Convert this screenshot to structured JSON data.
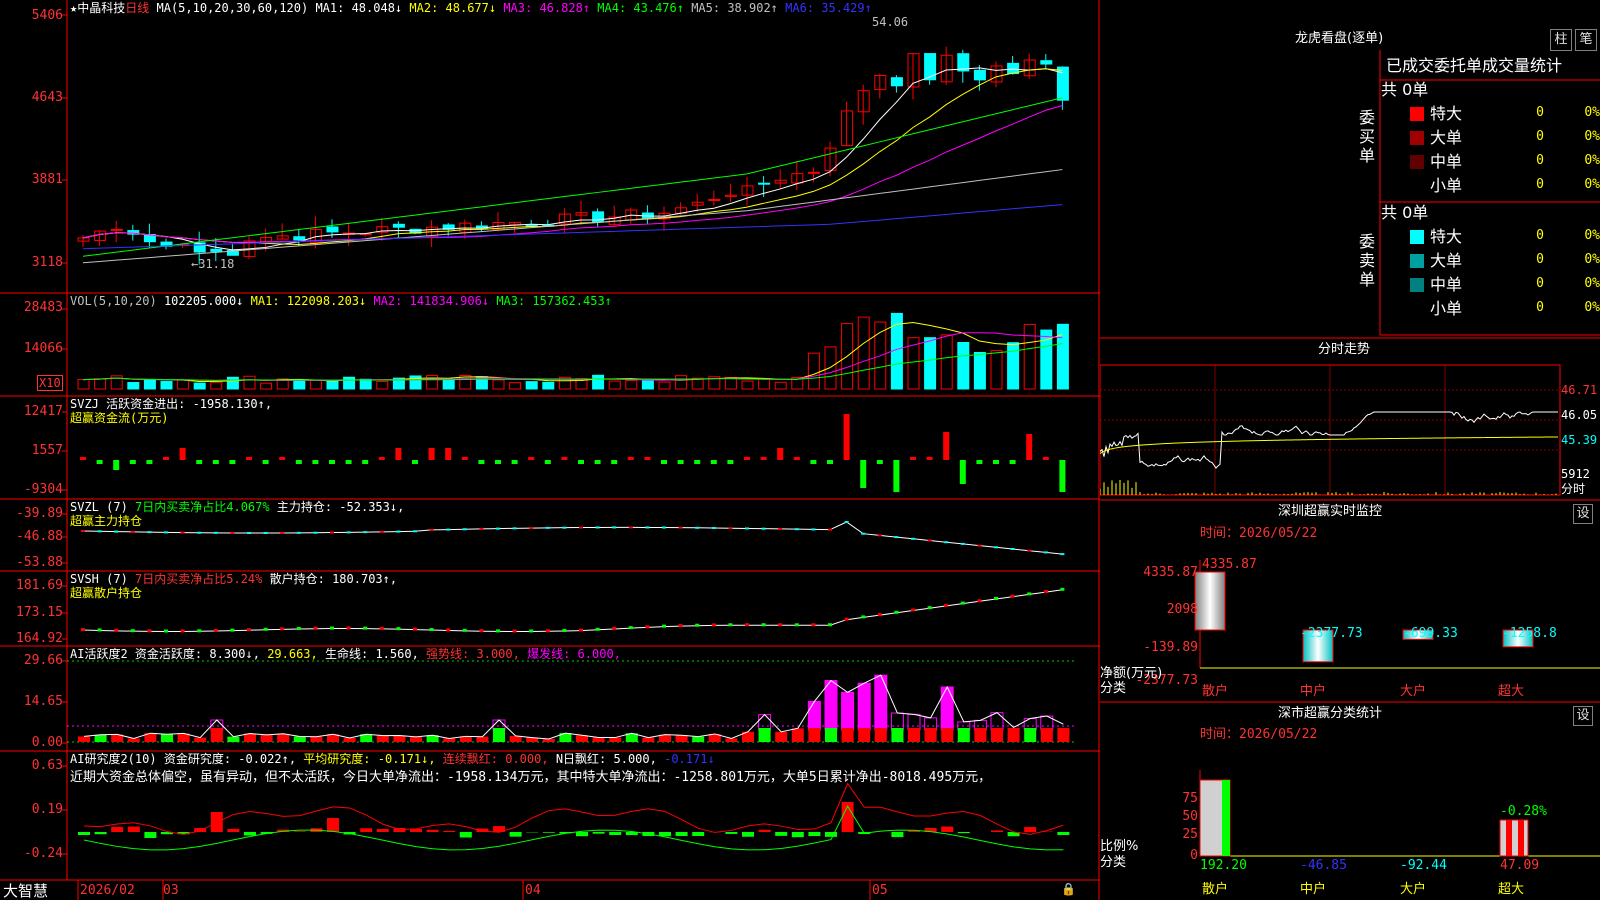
{
  "stock": {
    "star": "★",
    "name": "中晶科技",
    "period": "日线"
  },
  "price_panel": {
    "ma_params": "MA(5,10,20,30,60,120)",
    "ma": [
      {
        "label": "MA1: 48.048↓",
        "color": "#ffffff"
      },
      {
        "label": "MA2: 48.677↓",
        "color": "#ffff00"
      },
      {
        "label": "MA3: 46.828↑",
        "color": "#ff00ff"
      },
      {
        "label": "MA4: 43.476↑",
        "color": "#00ff00"
      },
      {
        "label": "MA5: 38.902↑",
        "color": "#c0c0c0"
      },
      {
        "label": "MA6: 35.429↑",
        "color": "#3333ff"
      }
    ],
    "y_ticks": [
      "5406",
      "4643",
      "3881",
      "3118"
    ],
    "high_mark": "54.06",
    "low_mark": "←31.18"
  },
  "vol_panel": {
    "title": "VOL(5,10,20)",
    "items": [
      {
        "label": "102205.000↓",
        "color": "#ffffff"
      },
      {
        "label": "MA1: 122098.203↓",
        "color": "#ffff00"
      },
      {
        "label": "MA2: 141834.906↓",
        "color": "#ff00ff"
      },
      {
        "label": "MA3: 157362.453↑",
        "color": "#00ff00"
      }
    ],
    "y_ticks": [
      "28483",
      "14066"
    ],
    "unit": "X10"
  },
  "svzj_panel": {
    "line1": [
      {
        "label": "SVZJ  活跃资金进出: -1958.130↑,",
        "color": "#ffffff"
      }
    ],
    "line2": "超赢资金流(万元)",
    "y_ticks": [
      "12417",
      "1557",
      "-9304"
    ]
  },
  "svzl_panel": {
    "line1": [
      {
        "label": "SVZL (7)",
        "color": "#ffffff"
      },
      {
        "label": "7日内买卖净占比4.067%",
        "color": "#00ff00"
      },
      {
        "label": "主力持仓: -52.353↓,",
        "color": "#ffffff"
      }
    ],
    "line2": "超赢主力持仓",
    "y_ticks": [
      "-39.89",
      "-46.88",
      "-53.88"
    ]
  },
  "svsh_panel": {
    "line1": [
      {
        "label": "SVSH (7)",
        "color": "#ffffff"
      },
      {
        "label": "7日内买卖净占比5.24%",
        "color": "#ff3333"
      },
      {
        "label": "散户持仓: 180.703↑,",
        "color": "#ffffff"
      }
    ],
    "line2": "超赢散户持仓",
    "y_ticks": [
      "181.69",
      "173.15",
      "164.92"
    ]
  },
  "ai_active_panel": {
    "line1": [
      {
        "label": "AI活跃度2",
        "color": "#ffffff"
      },
      {
        "label": "资金活跃度: 8.300↓,",
        "color": "#ffffff"
      },
      {
        "label": "29.663,",
        "color": "#ffff00"
      },
      {
        "label": "生命线: 1.560,",
        "color": "#ffffff"
      },
      {
        "label": "强势线: 3.000,",
        "color": "#ff3333"
      },
      {
        "label": "爆发线: 6.000,",
        "color": "#ff00ff"
      }
    ],
    "y_ticks": [
      "29.66",
      "14.65",
      "0.00"
    ]
  },
  "ai_research_panel": {
    "line1": [
      {
        "label": "AI研究度2(10)",
        "color": "#ffffff"
      },
      {
        "label": "资金研究度: -0.022↑,",
        "color": "#ffffff"
      },
      {
        "label": "平均研究度: -0.171↓,",
        "color": "#ffff00"
      },
      {
        "label": "连续飘红: 0.000,",
        "color": "#ff3333"
      },
      {
        "label": "N日飘红: 5.000,",
        "color": "#ffffff"
      },
      {
        "label": "-0.171↓",
        "color": "#3333ff"
      }
    ],
    "comment": "近期大资金总体偏空，虽有异动，但不太活跃，今日大单净流出：-1958.134万元，其中特大单净流出：-1258.801万元，大单5日累计净出-8018.495万元，",
    "y_ticks": [
      "0.63",
      "0.19",
      "-0.24"
    ]
  },
  "bottom_axis": {
    "logo": "大智慧",
    "dates": [
      "2026/02",
      "03",
      "04",
      "05"
    ]
  },
  "dragon_tiger": {
    "title": "龙虎看盘(逐单)",
    "btn_bar": "柱",
    "btn_pen": "笔",
    "tabs": [
      "已成交",
      "委托单",
      "成交量统计"
    ],
    "buy_label": "委买单",
    "sell_label": "委卖单",
    "buy_total": "共 0单",
    "sell_total": "共 0单",
    "buy_rows": [
      {
        "name": "特大",
        "count": "0",
        "pct": "0%",
        "color": "#ff0000"
      },
      {
        "name": "大单",
        "count": "0",
        "pct": "0%",
        "color": "#a00000"
      },
      {
        "name": "中单",
        "count": "0",
        "pct": "0%",
        "color": "#600000"
      },
      {
        "name": "小单",
        "count": "0",
        "pct": "0%",
        "color": ""
      }
    ],
    "sell_rows": [
      {
        "name": "特大",
        "count": "0",
        "pct": "0%",
        "color": "#00ffff"
      },
      {
        "name": "大单",
        "count": "0",
        "pct": "0%",
        "color": "#00a0a0"
      },
      {
        "name": "中单",
        "count": "0",
        "pct": "0%",
        "color": "#008080"
      },
      {
        "name": "小单",
        "count": "0",
        "pct": "0%",
        "color": ""
      }
    ]
  },
  "intraday": {
    "title": "分时走势",
    "ticks_right": [
      "46.71",
      "46.05",
      "45.39",
      "5912",
      "分时"
    ]
  },
  "sz_monitor": {
    "title": "深圳超赢实时监控",
    "settings": "设",
    "time": "时间：2026/05/22",
    "y_ticks": [
      "4335.87",
      "2098",
      "-139.89",
      "-2377.73"
    ],
    "ylabel": "净额(万元)",
    "xlabel": "分类",
    "categories": [
      "散户",
      "中户",
      "大户",
      "超大"
    ],
    "value_labels": [
      "4335.87",
      "-2377.73",
      "-699.33",
      "-1258.8"
    ],
    "values": [
      4335.87,
      -2377.73,
      -699.33,
      -1258.8
    ]
  },
  "sz_class": {
    "title": "深市超赢分类统计",
    "settings": "设",
    "time": "时间：2026/05/22",
    "y_ticks": [
      "75",
      "50",
      "25",
      "0"
    ],
    "ylabel": "比例%",
    "xlabel": "分类",
    "categories": [
      "散户",
      "中户",
      "大户",
      "超大"
    ],
    "value_labels": [
      "192.20",
      "-46.85",
      "-92.44",
      "47.09"
    ],
    "top_label": "-0.28%"
  }
}
